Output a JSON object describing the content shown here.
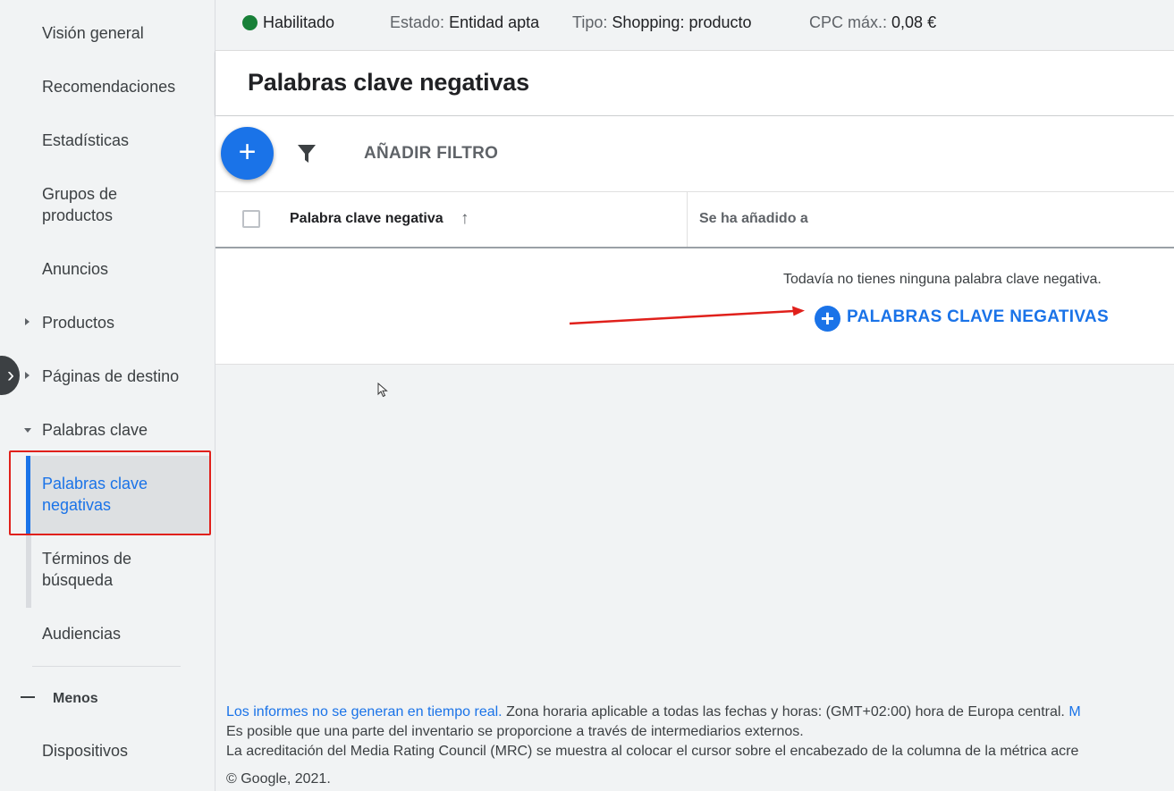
{
  "sidebar": {
    "items": [
      {
        "label": "Visión general"
      },
      {
        "label": "Recomendaciones"
      },
      {
        "label": "Estadísticas"
      },
      {
        "label": "Grupos de productos"
      },
      {
        "label": "Anuncios"
      },
      {
        "label": "Productos"
      },
      {
        "label": "Páginas de destino"
      },
      {
        "label": "Palabras clave"
      }
    ],
    "subitems": [
      {
        "label": "Palabras clave negativas",
        "active": true
      },
      {
        "label": "Términos de búsqueda"
      }
    ],
    "audiences": "Audiencias",
    "less": "Menos",
    "devices": "Dispositivos"
  },
  "topbar": {
    "status": "Habilitado",
    "status_color": "#188038",
    "state_label": "Estado:",
    "state_value": "Entidad apta",
    "type_label": "Tipo:",
    "type_value": "Shopping: producto",
    "cpc_label": "CPC máx.:",
    "cpc_value": "0,08 €"
  },
  "page": {
    "title": "Palabras clave negativas"
  },
  "toolbar": {
    "add_filter": "AÑADIR FILTRO"
  },
  "table": {
    "columns": [
      "Palabra clave negativa",
      "Se ha añadido a"
    ],
    "empty_message": "Todavía no tienes ninguna palabra clave negativa.",
    "add_button": "PALABRAS CLAVE NEGATIVAS"
  },
  "footer": {
    "line1_link": "Los informes no se generan en tiempo real.",
    "line1_text": " Zona horaria aplicable a todas las fechas y horas: (GMT+02:00) hora de Europa central. ",
    "line1_tail": "M",
    "line2": "Es posible que una parte del inventario se proporcione a través de intermediarios externos.",
    "line3": "La acreditación del Media Rating Council (MRC) se muestra al colocar el cursor sobre el encabezado de la columna de la métrica acre",
    "copyright": "© Google, 2021."
  },
  "colors": {
    "accent": "#1a73e8",
    "annotation": "#e0201b"
  }
}
